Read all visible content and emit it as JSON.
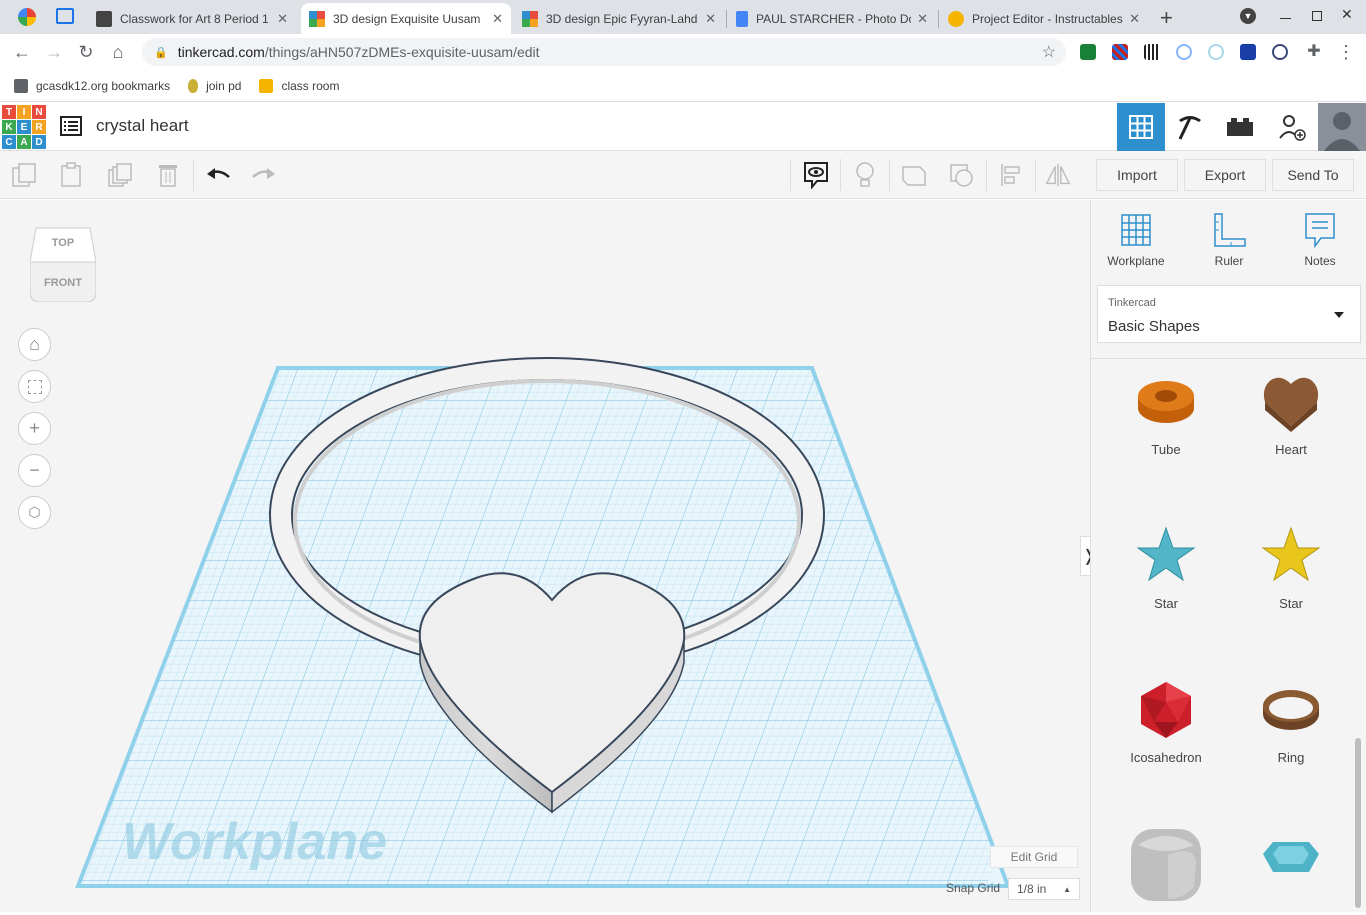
{
  "browser": {
    "tabs": [
      {
        "title": "Classwork for Art 8 Period 1",
        "active": false
      },
      {
        "title": "3D design Exquisite Uusam",
        "active": true
      },
      {
        "title": "3D design Epic Fyyran-Lahd",
        "active": false
      },
      {
        "title": "PAUL STARCHER - Photo Do",
        "active": false
      },
      {
        "title": "Project Editor - Instructables",
        "active": false
      }
    ],
    "url_host": "tinkercad.com",
    "url_path": "/things/aHN507zDMEs-exquisite-uusam/edit",
    "bookmarks": [
      "gcasdk12.org bookmarks",
      "join pd",
      "class room"
    ]
  },
  "app": {
    "logo_letters": [
      "T",
      "I",
      "N",
      "K",
      "E",
      "R",
      "C",
      "A",
      "D"
    ],
    "design_title": "crystal heart"
  },
  "toolbar": {
    "import_label": "Import",
    "export_label": "Export",
    "send_to_label": "Send To"
  },
  "viewport": {
    "viewcube_top": "TOP",
    "viewcube_front": "FRONT",
    "workplane_watermark": "Workplane",
    "edit_grid_label": "Edit Grid",
    "snap_grid_label": "Snap Grid",
    "snap_grid_value": "1/8 in"
  },
  "panel": {
    "tools": [
      "Workplane",
      "Ruler",
      "Notes"
    ],
    "library_source": "Tinkercad",
    "library_name": "Basic Shapes",
    "shapes": [
      "Tube",
      "Heart",
      "Star",
      "Star",
      "Icosahedron",
      "Ring"
    ]
  },
  "colors": {
    "accent_blue": "#2e8fcf",
    "grid_blue": "#9fd3ea",
    "tube_orange": "#e07b1a",
    "heart_brown": "#8b5a34",
    "star_teal": "#52b6c8",
    "star_yellow": "#e8c61c",
    "icosa_red": "#cc1f2a",
    "ring_brown": "#8a5a32"
  }
}
